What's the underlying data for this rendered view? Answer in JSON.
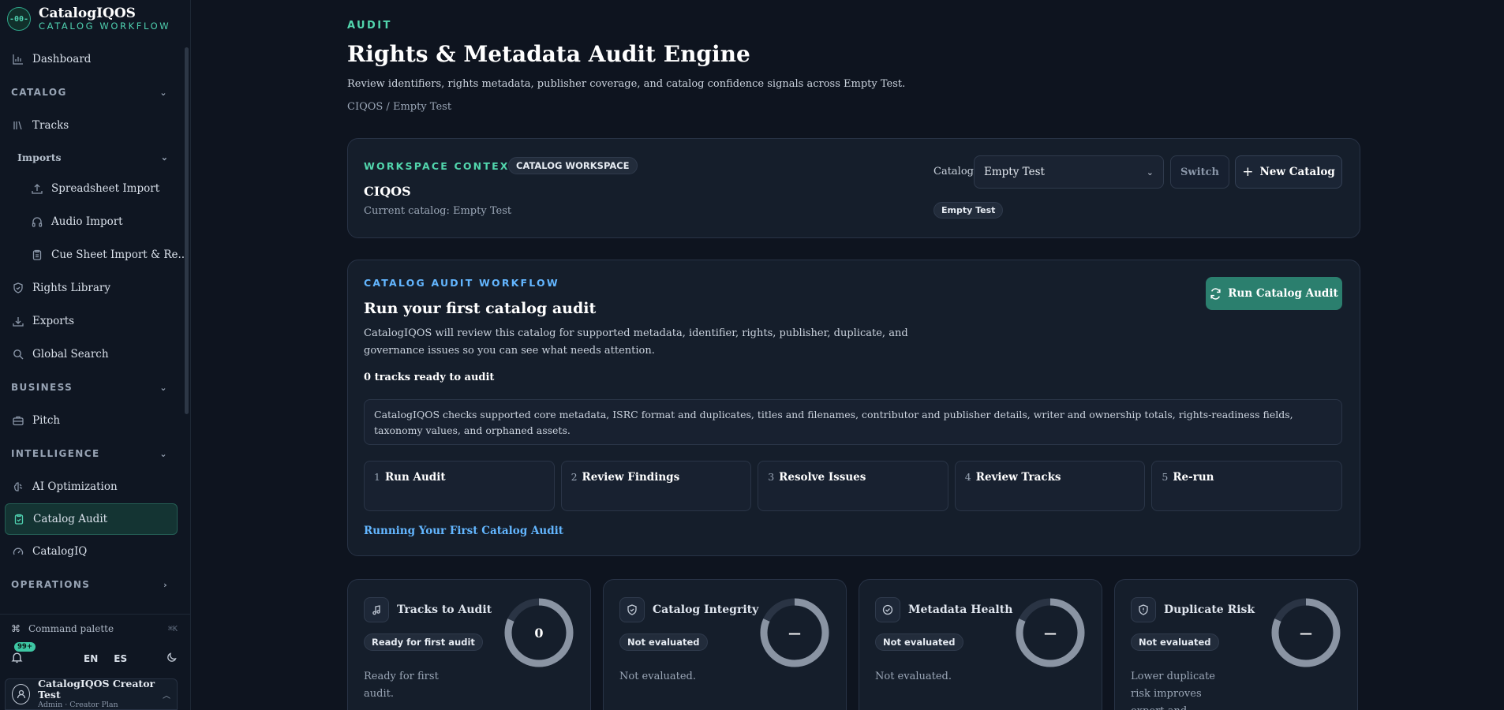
{
  "sidebar": {
    "brand_name": "CatalogIQOS",
    "brand_sub": "CATALOG WORKFLOW",
    "logo_glyph": "-00-",
    "dashboard": "Dashboard",
    "catalog_section": "CATALOG",
    "tracks": "Tracks",
    "imports_section": "Imports",
    "spreadsheet_import": "Spreadsheet Import",
    "audio_import": "Audio Import",
    "cue_sheet": "Cue Sheet Import & Re...",
    "rights_library": "Rights Library",
    "exports": "Exports",
    "global_search": "Global Search",
    "business_section": "BUSINESS",
    "pitch": "Pitch",
    "intelligence_section": "INTELLIGENCE",
    "ai_optimization": "AI Optimization",
    "catalog_audit": "Catalog Audit",
    "catalogiq": "CatalogIQ",
    "operations_section": "OPERATIONS",
    "command_palette": "Command palette",
    "command_kbd": "⌘K",
    "notif_badge": "99+",
    "lang_en": "EN",
    "lang_es": "ES",
    "user_name": "CatalogIQOS Creator Test",
    "user_role": "Admin · Creator Plan"
  },
  "header": {
    "eyebrow": "AUDIT",
    "title": "Rights & Metadata Audit Engine",
    "description": "Review identifiers, rights metadata, publisher coverage, and catalog confidence signals across Empty Test.",
    "breadcrumb": "CIQOS / Empty Test"
  },
  "context": {
    "label": "WORKSPACE CONTEXT",
    "pill": "CATALOG WORKSPACE",
    "name": "CIQOS",
    "current": "Current catalog: Empty Test",
    "catalog_label": "Catalog",
    "catalog_value": "Empty Test",
    "switch": "Switch",
    "new_catalog": "New Catalog",
    "chip": "Empty Test"
  },
  "workflow": {
    "label": "CATALOG AUDIT WORKFLOW",
    "title": "Run your first catalog audit",
    "description": "CatalogIQOS will review this catalog for supported metadata, identifier, rights, publisher, duplicate, and governance issues so you can see what needs attention.",
    "count": "0 tracks ready to audit",
    "run_button": "Run Catalog Audit",
    "info": "CatalogIQOS checks supported core metadata, ISRC format and duplicates, titles and filenames, contributor and publisher details, writer and ownership totals, rights-readiness fields, taxonomy values, and orphaned assets.",
    "steps": [
      {
        "num": "1",
        "label": "Run Audit"
      },
      {
        "num": "2",
        "label": "Review Findings"
      },
      {
        "num": "3",
        "label": "Resolve Issues"
      },
      {
        "num": "4",
        "label": "Review Tracks"
      },
      {
        "num": "5",
        "label": "Re-run"
      }
    ],
    "link": "Running Your First Catalog Audit"
  },
  "metrics": [
    {
      "title": "Tracks to Audit",
      "pill": "Ready for first audit",
      "value": "0",
      "desc": "Ready for first audit.",
      "icon": "music-note-icon"
    },
    {
      "title": "Catalog Integrity",
      "pill": "Not evaluated",
      "value": "—",
      "desc": "Not evaluated.",
      "icon": "shield-check-icon"
    },
    {
      "title": "Metadata Health",
      "pill": "Not evaluated",
      "value": "—",
      "desc": "Not evaluated.",
      "icon": "check-circle-icon"
    },
    {
      "title": "Duplicate Risk",
      "pill": "Not evaluated",
      "value": "—",
      "desc": "Lower duplicate risk improves export and",
      "icon": "shield-alert-icon"
    }
  ],
  "colors": {
    "accent_green": "#52d6ad",
    "accent_blue": "#63b6ff",
    "run_button": "#2b7f6e",
    "ring_track": "#2a3444",
    "ring_fill": "#8a94a3"
  }
}
